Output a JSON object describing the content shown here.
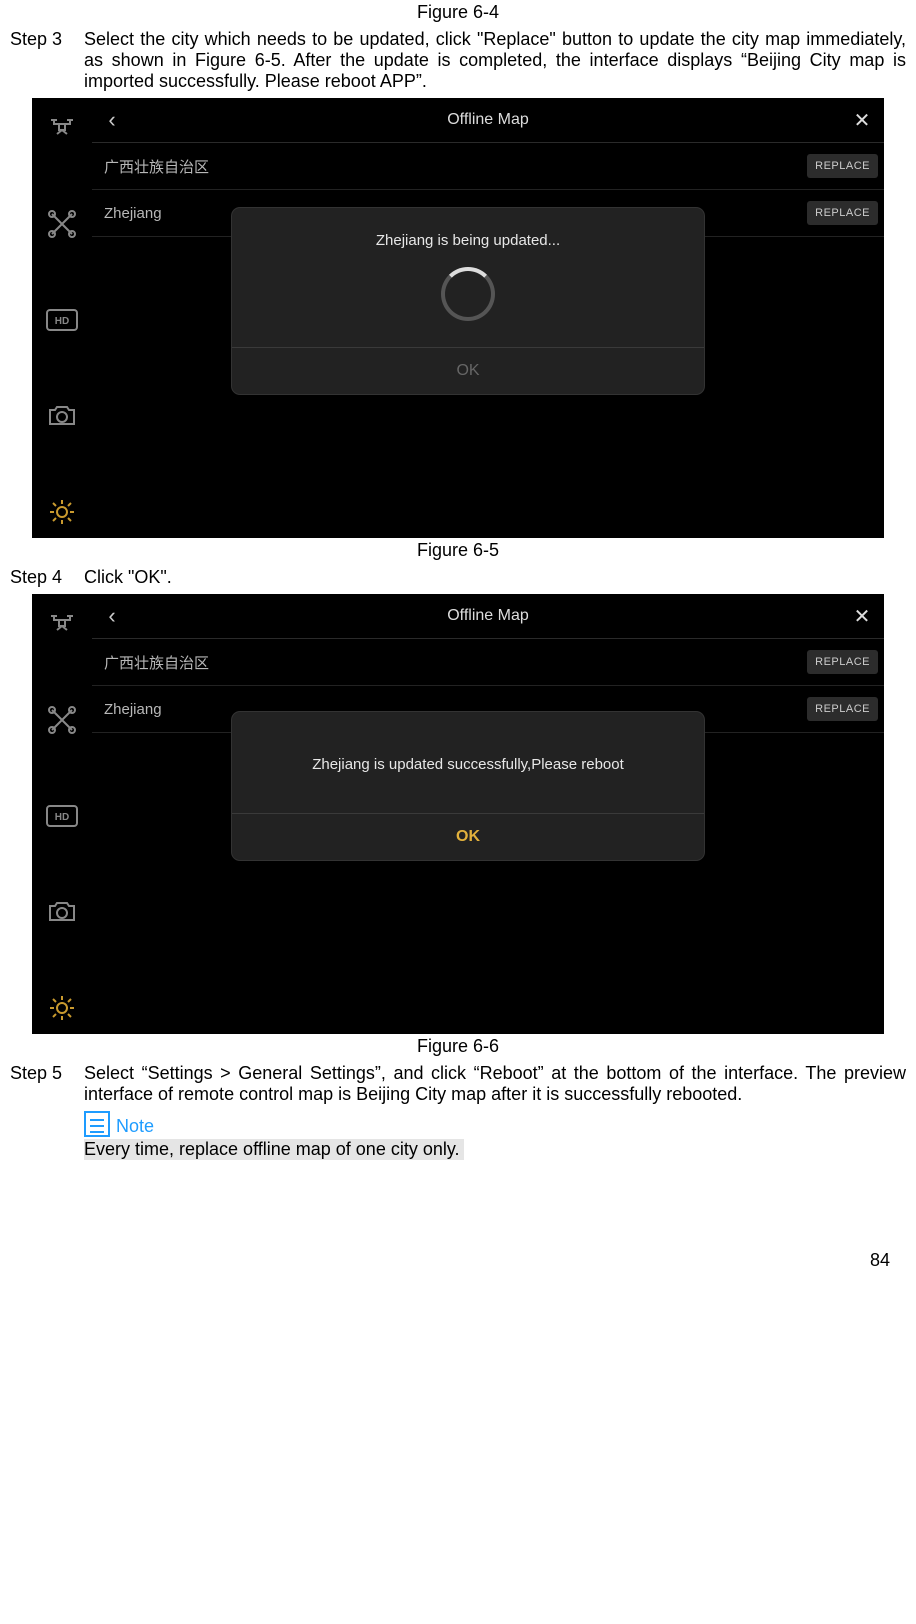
{
  "captions": {
    "fig64": "Figure 6-4",
    "fig65": "Figure 6-5",
    "fig66": "Figure 6-6"
  },
  "steps": {
    "s3_label": "Step 3",
    "s3_body": "Select the city which needs to be updated, click \"Replace\" button to update the city map immediately, as shown in Figure 6-5. After the update is completed, the interface displays “Beijing City map is imported successfully. Please reboot APP”.",
    "s4_label": "Step 4",
    "s4_body": "Click \"OK\".",
    "s5_label": "Step 5",
    "s5_body": "Select “Settings > General Settings”, and click “Reboot” at the bottom of the interface. The preview interface of remote control map is Beijing City map after it is successfully rebooted."
  },
  "ui": {
    "title": "Offline Map",
    "back_glyph": "‹",
    "close_glyph": "✕",
    "row1": "广西壮族自治区",
    "row2": "Zhejiang",
    "replace": "REPLACE",
    "dlg_updating": "Zhejiang is being updated...",
    "dlg_success": "Zhejiang is updated successfully,Please reboot",
    "ok": "OK"
  },
  "note": {
    "label": "Note",
    "text": "Every time, replace offline map of one city only."
  },
  "page_number": "84"
}
